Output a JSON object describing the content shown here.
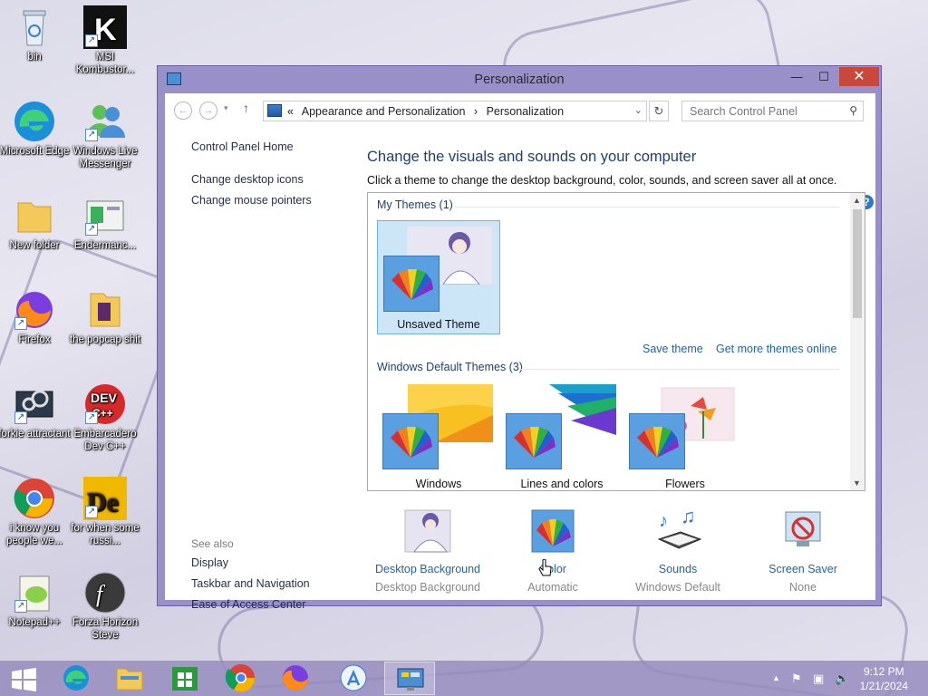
{
  "desktop": {
    "icons": [
      {
        "label": "bin",
        "icon": "recycle-bin-icon"
      },
      {
        "label": "MSI Kombustor...",
        "icon": "kombustor-icon"
      },
      {
        "label": "Microsoft Edge",
        "icon": "edge-icon"
      },
      {
        "label": "Windows Live Messenger",
        "icon": "messenger-icon"
      },
      {
        "label": "New folder",
        "icon": "folder-icon"
      },
      {
        "label": "Endermanc...",
        "icon": "endermanch-icon"
      },
      {
        "label": "Firefox",
        "icon": "firefox-icon"
      },
      {
        "label": "the popcap shit",
        "icon": "folder-icon"
      },
      {
        "label": "forkie attractant",
        "icon": "settings-monitor-icon"
      },
      {
        "label": "Embarcadero Dev C++",
        "icon": "devcpp-icon"
      },
      {
        "label": "i know you people we...",
        "icon": "chrome-icon"
      },
      {
        "label": "for when some russi...",
        "icon": "de-app-icon"
      },
      {
        "label": "Notepad++",
        "icon": "notepadpp-icon"
      },
      {
        "label": "Forza Horizon Steve",
        "icon": "flash-icon"
      }
    ]
  },
  "window": {
    "title": "Personalization",
    "buttons": {
      "minimize": "—",
      "maximize": "☐",
      "close": "✕"
    },
    "address": {
      "prefix": "«",
      "crumbs": [
        "Appearance and Personalization",
        "›",
        "Personalization"
      ]
    },
    "search_placeholder": "Search Control Panel",
    "help": "?",
    "left_pane": {
      "home": "Control Panel Home",
      "links": [
        "Change desktop icons",
        "Change mouse pointers"
      ],
      "see_also_title": "See also",
      "see_also": [
        "Display",
        "Taskbar and Navigation",
        "Ease of Access Center"
      ]
    },
    "main": {
      "heading": "Change the visuals and sounds on your computer",
      "subtext": "Click a theme to change the desktop background, color, sounds, and screen saver all at once.",
      "my_themes_label": "My Themes (1)",
      "my_themes": [
        {
          "name": "Unsaved Theme",
          "selected": true
        }
      ],
      "save_theme": "Save theme",
      "get_more": "Get more themes online",
      "default_label": "Windows Default Themes (3)",
      "default_themes": [
        {
          "name": "Windows"
        },
        {
          "name": "Lines and colors"
        },
        {
          "name": "Flowers"
        }
      ]
    },
    "bottom": [
      {
        "name": "Desktop Background",
        "value": "Desktop Background",
        "icon": "desktop-background-icon"
      },
      {
        "name": "Color",
        "value": "Automatic",
        "icon": "color-palette-icon"
      },
      {
        "name": "Sounds",
        "value": "Windows Default",
        "icon": "sounds-icon"
      },
      {
        "name": "Screen Saver",
        "value": "None",
        "icon": "screen-saver-icon"
      }
    ]
  },
  "taskbar": {
    "items": [
      "start-icon",
      "edge-icon",
      "file-explorer-icon",
      "store-icon",
      "chrome-icon",
      "firefox-icon",
      "app-store-icon",
      "control-panel-icon"
    ],
    "time": "9:12 PM",
    "date": "1/21/2024"
  }
}
